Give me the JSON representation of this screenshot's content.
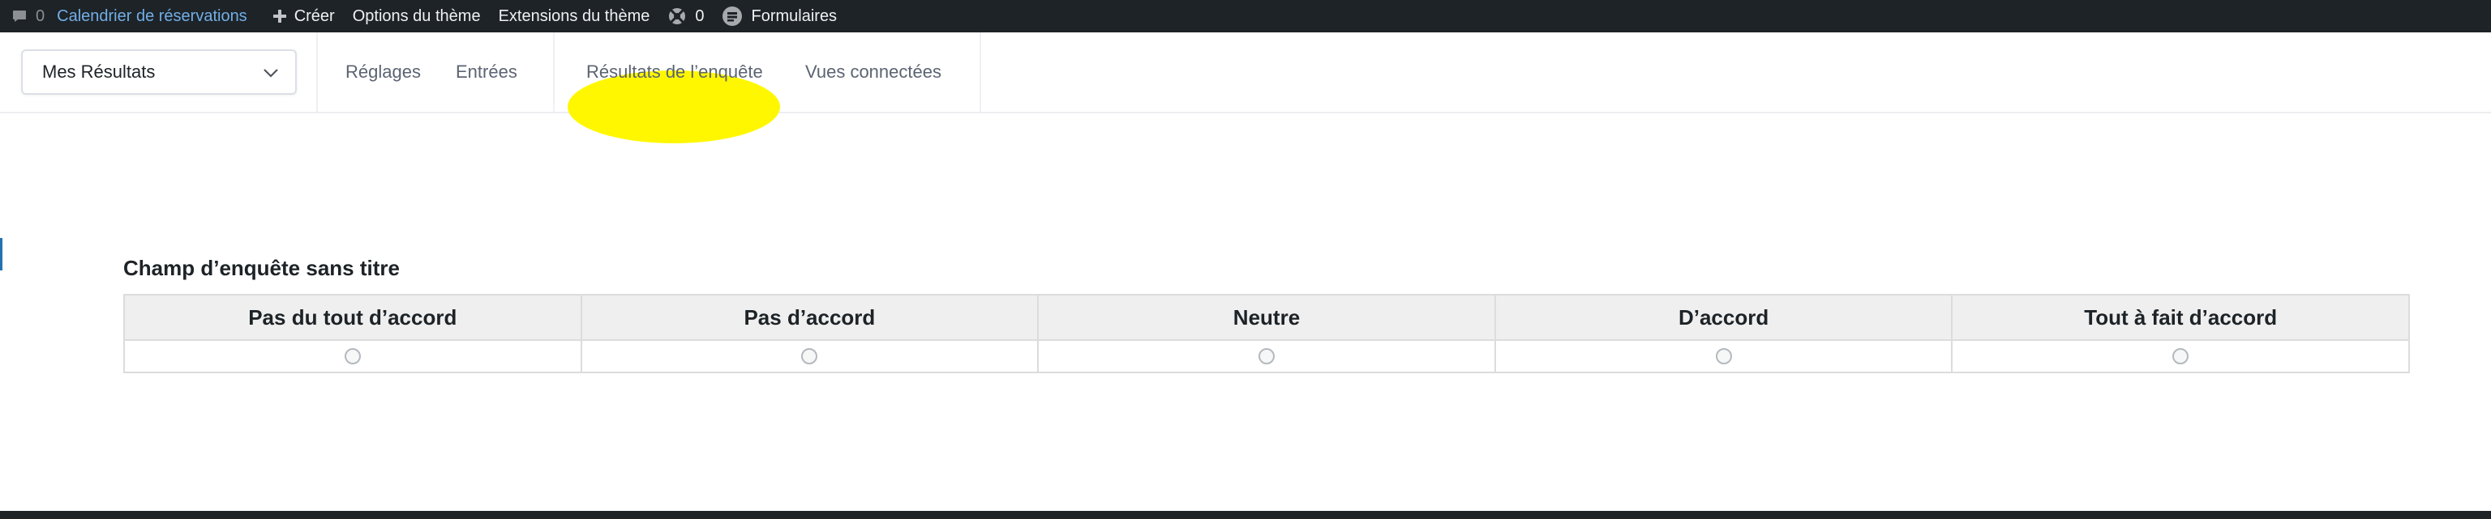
{
  "admin_bar": {
    "comments_count": "0",
    "site_name": "Calendrier de réservations",
    "new_label": "Créer",
    "theme_options": "Options du thème",
    "theme_extensions": "Extensions du thème",
    "plugin_count": "0",
    "forms_label": "Formulaires"
  },
  "subnav": {
    "form_select_value": "Mes Résultats",
    "tabs": [
      {
        "label": "Réglages"
      },
      {
        "label": "Entrées"
      },
      {
        "label": "Résultats de l’enquête"
      },
      {
        "label": "Vues connectées"
      }
    ],
    "highlight_color": "#fff700"
  },
  "survey": {
    "title": "Champ d’enquête sans titre",
    "columns": [
      "Pas du tout d’accord",
      "Pas d’accord",
      "Neutre",
      "D’accord",
      "Tout à fait d’accord"
    ]
  },
  "colors": {
    "admin_bar_bg": "#1d2327",
    "admin_bar_active": "#72aee6",
    "header_cell_bg": "#efefef"
  }
}
